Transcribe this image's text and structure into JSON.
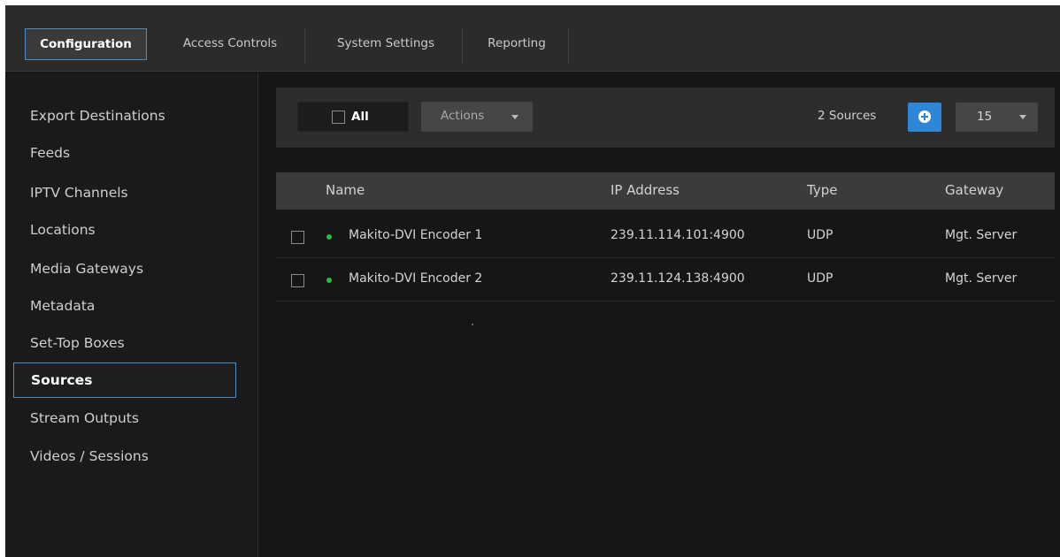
{
  "tabs": [
    {
      "label": "Configuration",
      "active": true
    },
    {
      "label": "Access Controls",
      "active": false
    },
    {
      "label": "System Settings",
      "active": false
    },
    {
      "label": "Reporting",
      "active": false
    }
  ],
  "sidebar": {
    "items": [
      {
        "label": "Export Destinations",
        "active": false
      },
      {
        "label": "Feeds",
        "active": false
      },
      {
        "label": "IPTV Channels",
        "active": false
      },
      {
        "label": "Locations",
        "active": false
      },
      {
        "label": "Media Gateways",
        "active": false
      },
      {
        "label": "Metadata",
        "active": false
      },
      {
        "label": "Set-Top Boxes",
        "active": false
      },
      {
        "label": "Sources",
        "active": true
      },
      {
        "label": "Stream Outputs",
        "active": false
      },
      {
        "label": "Videos / Sessions",
        "active": false
      }
    ]
  },
  "toolbar": {
    "select_all_label": "All",
    "actions_label": "Actions",
    "count_text": "2 Sources",
    "add_icon": "plus-circle-icon",
    "page_size": "15"
  },
  "table": {
    "columns": [
      "Name",
      "IP Address",
      "Type",
      "Gateway"
    ],
    "rows": [
      {
        "status": "online",
        "name": "Makito-DVI Encoder 1",
        "ip": "239.11.114.101:4900",
        "type": "UDP",
        "gateway": "Mgt. Server"
      },
      {
        "status": "online",
        "name": "Makito-DVI Encoder 2",
        "ip": "239.11.124.138:4900",
        "type": "UDP",
        "gateway": "Mgt. Server"
      }
    ]
  },
  "colors": {
    "accent": "#2e86d6",
    "active_outline": "#4b8ec7",
    "status_online": "#2bbd3a",
    "background": "#161616"
  }
}
